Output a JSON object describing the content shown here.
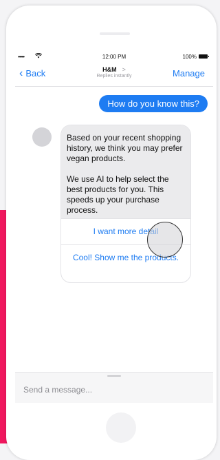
{
  "status": {
    "signal": "•••••",
    "time": "12:00 PM",
    "battery": "100%"
  },
  "nav": {
    "back_label": "Back",
    "title": "H&M",
    "title_chevron": ">",
    "subtitle": "Replies instantly",
    "manage_label": "Manage"
  },
  "messages": {
    "user_message": "How do you know this?",
    "bot_paragraph_1": "Based on your recent shopping history, we think you may prefer vegan products.",
    "bot_paragraph_2": "We use AI to help select the best products for you.  This speeds up your purchase process."
  },
  "quick_replies": [
    {
      "label": "I want more detail"
    },
    {
      "label": "Cool! Show me the products."
    }
  ],
  "composer": {
    "placeholder": "Send a message..."
  },
  "colors": {
    "accent": "#1e7cf2",
    "pink_band": "#f0175e",
    "bubble_gray": "#ebebed"
  },
  "icons": [
    "back-chevron-icon",
    "wifi-icon",
    "battery-icon"
  ]
}
